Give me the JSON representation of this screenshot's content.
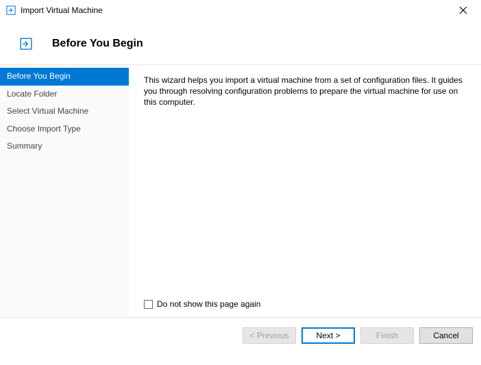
{
  "window": {
    "title": "Import Virtual Machine"
  },
  "header": {
    "page_title": "Before You Begin"
  },
  "sidebar": {
    "steps": [
      {
        "label": "Before You Begin",
        "active": true
      },
      {
        "label": "Locate Folder",
        "active": false
      },
      {
        "label": "Select Virtual Machine",
        "active": false
      },
      {
        "label": "Choose Import Type",
        "active": false
      },
      {
        "label": "Summary",
        "active": false
      }
    ]
  },
  "main": {
    "description": "This wizard helps you import a virtual machine from a set of configuration files. It guides you through resolving configuration problems to prepare the virtual machine for use on this computer.",
    "checkbox_label": "Do not show this page again"
  },
  "footer": {
    "previous": "< Previous",
    "next": "Next >",
    "finish": "Finish",
    "cancel": "Cancel"
  }
}
